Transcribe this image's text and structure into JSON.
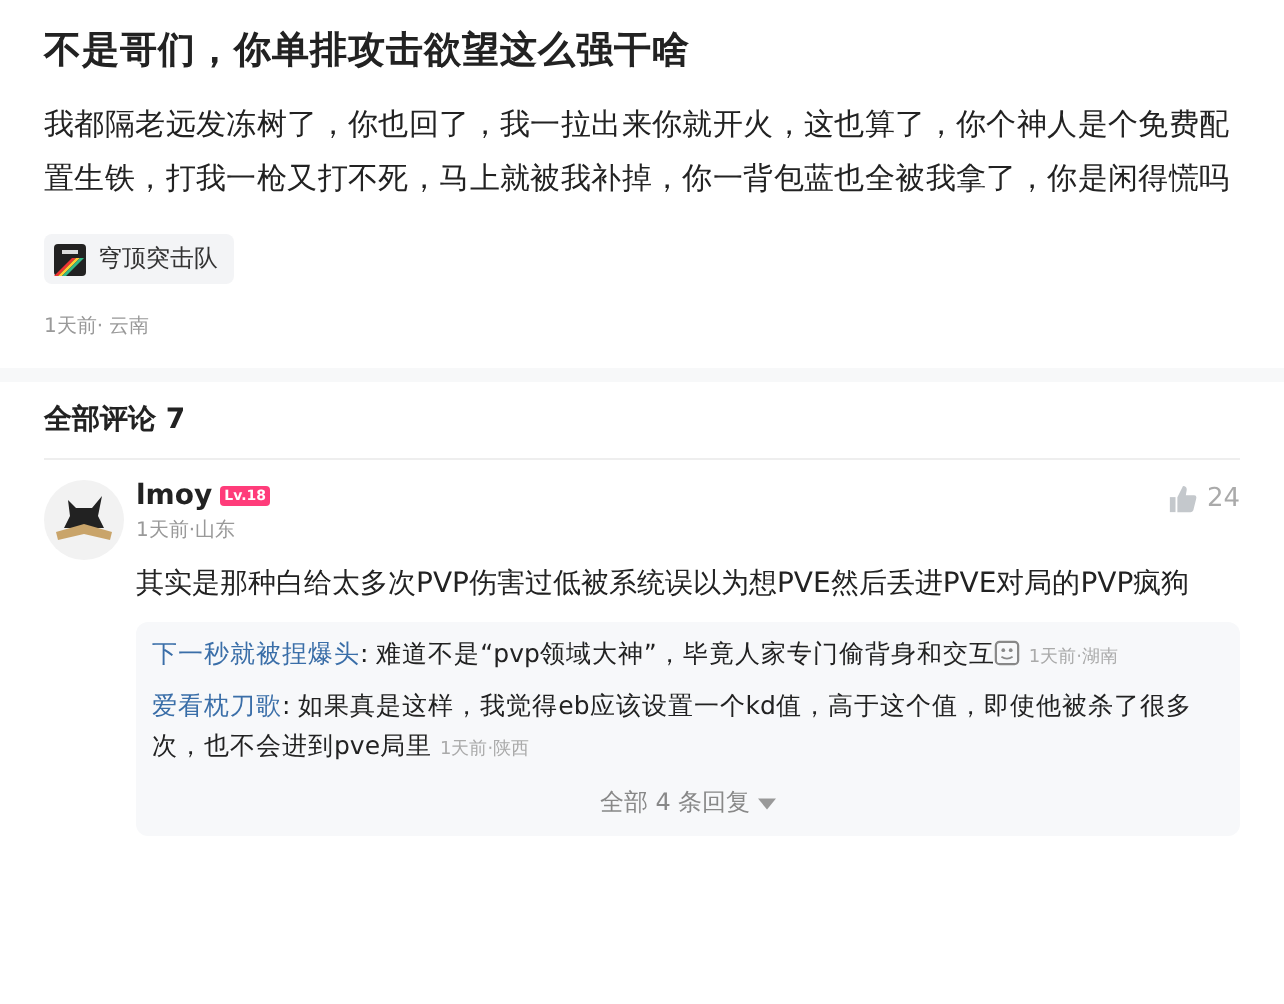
{
  "post": {
    "title": "不是哥们，你单排攻击欲望这么强干啥",
    "body": "我都隔老远发冻树了，你也回了，我一拉出来你就开火，这也算了，你个神人是个免费配置生铁，打我一枪又打不死，马上就被我补掉，你一背包蓝也全被我拿了，你是闲得慌吗",
    "tag": "穹顶突击队",
    "meta": "1天前· 云南"
  },
  "comments_header": "全部评论 7",
  "comment": {
    "user": "lmoy",
    "level": "Lv.18",
    "meta": "1天前·山东",
    "likes": "24",
    "text": "其实是那种白给太多次PVP伤害过低被系统误以为想PVE然后丢进PVE对局的PVP疯狗",
    "replies": [
      {
        "user": "下一秒就被捏爆头",
        "text": ": 难道不是“pvp领域大神”，毕竟人家专门偷背身和交互",
        "emoji": true,
        "time": "1天前·湖南"
      },
      {
        "user": "爱看枕刀歌",
        "text": ": 如果真是这样，我觉得eb应该设置一个kd值，高于这个值，即使他被杀了很多次，也不会进到pve局里",
        "emoji": false,
        "time": "1天前·陕西"
      }
    ],
    "more_replies": "全部 4 条回复"
  }
}
